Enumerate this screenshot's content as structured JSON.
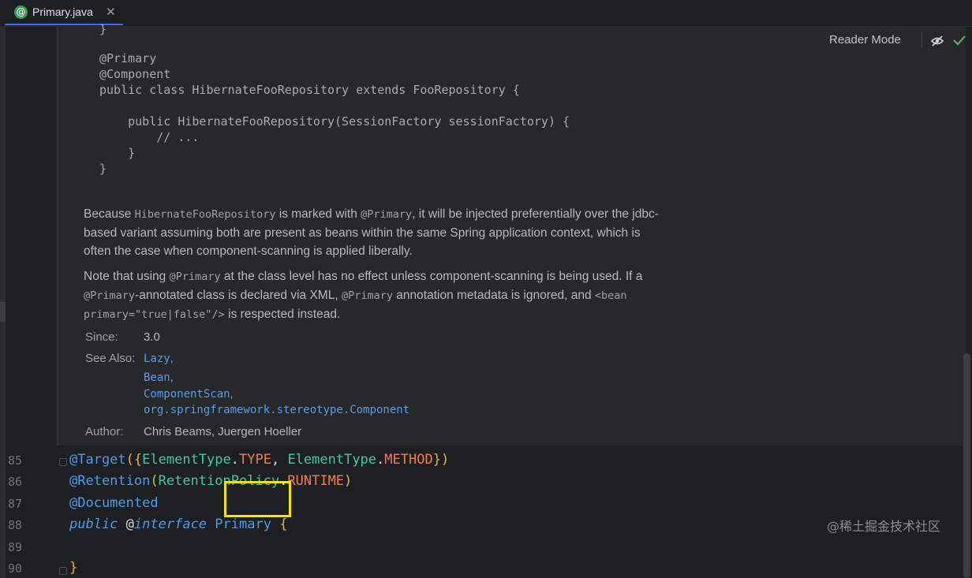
{
  "tab": {
    "label": "Primary.java",
    "icon": "@",
    "close": "✕"
  },
  "toolbar": {
    "reader_mode": "Reader Mode"
  },
  "doc": {
    "code_lines": [
      "}",
      "",
      "@Primary",
      "@Component",
      "public class HibernateFooRepository extends FooRepository {",
      "",
      "    public HibernateFooRepository(SessionFactory sessionFactory) {",
      "        // ...",
      "    }",
      "}"
    ],
    "para1": {
      "t1": "Because ",
      "c1": "HibernateFooRepository",
      "t2": " is marked with ",
      "c2": "@Primary",
      "t3": ", it will be injected preferentially over the jdbc-",
      "line2": "based variant assuming both are present as beans within the same Spring application context, which is",
      "line3": "often the case when component-scanning is applied liberally."
    },
    "para2": {
      "t1": "Note that using ",
      "c1": "@Primary",
      "t2": " at the class level has no effect unless component-scanning is being used. If a",
      "c2": "@Primary",
      "t3": "-annotated class is declared via XML, ",
      "c3": "@Primary",
      "t4": " annotation metadata is ignored, and ",
      "c4": "<bean",
      "c5": "primary=\"true|false\"/>",
      "t5": " is respected instead."
    },
    "since_label": "Since:",
    "since_value": "3.0",
    "see_also_label": "See Also:",
    "see_also": [
      "Lazy",
      "Bean",
      "ComponentScan",
      "org.springframework.stereotype.Component"
    ],
    "comma": ",",
    "author_label": "Author:",
    "author_value": "Chris Beams, Juergen Hoeller"
  },
  "lines": {
    "n85": "85",
    "n86": "86",
    "n87": "87",
    "n88": "88",
    "n89": "89",
    "n90": "90",
    "l85": {
      "a": "@Target",
      "p1": "(",
      "b1": "{",
      "c1": "ElementType",
      "d1": ".",
      "k1": "TYPE",
      "s": ", ",
      "c2": "ElementType",
      "d2": ".",
      "k2": "METHOD",
      "b2": "}",
      "p2": ")"
    },
    "l86": {
      "a": "@Retention",
      "p1": "(",
      "c1": "RetentionPolicy",
      "d1": ".",
      "k1": "RUNTIME",
      "p2": ")"
    },
    "l87": {
      "a": "@Documented"
    },
    "l88": {
      "kw1": "public",
      "sp": " ",
      "at": "@",
      "kw2": "interface",
      "sp2": " ",
      "name": "Primary",
      "sp3": " ",
      "brace": "{"
    },
    "l90": {
      "brace": "}"
    }
  },
  "watermark": "@稀土掘金技术社区"
}
